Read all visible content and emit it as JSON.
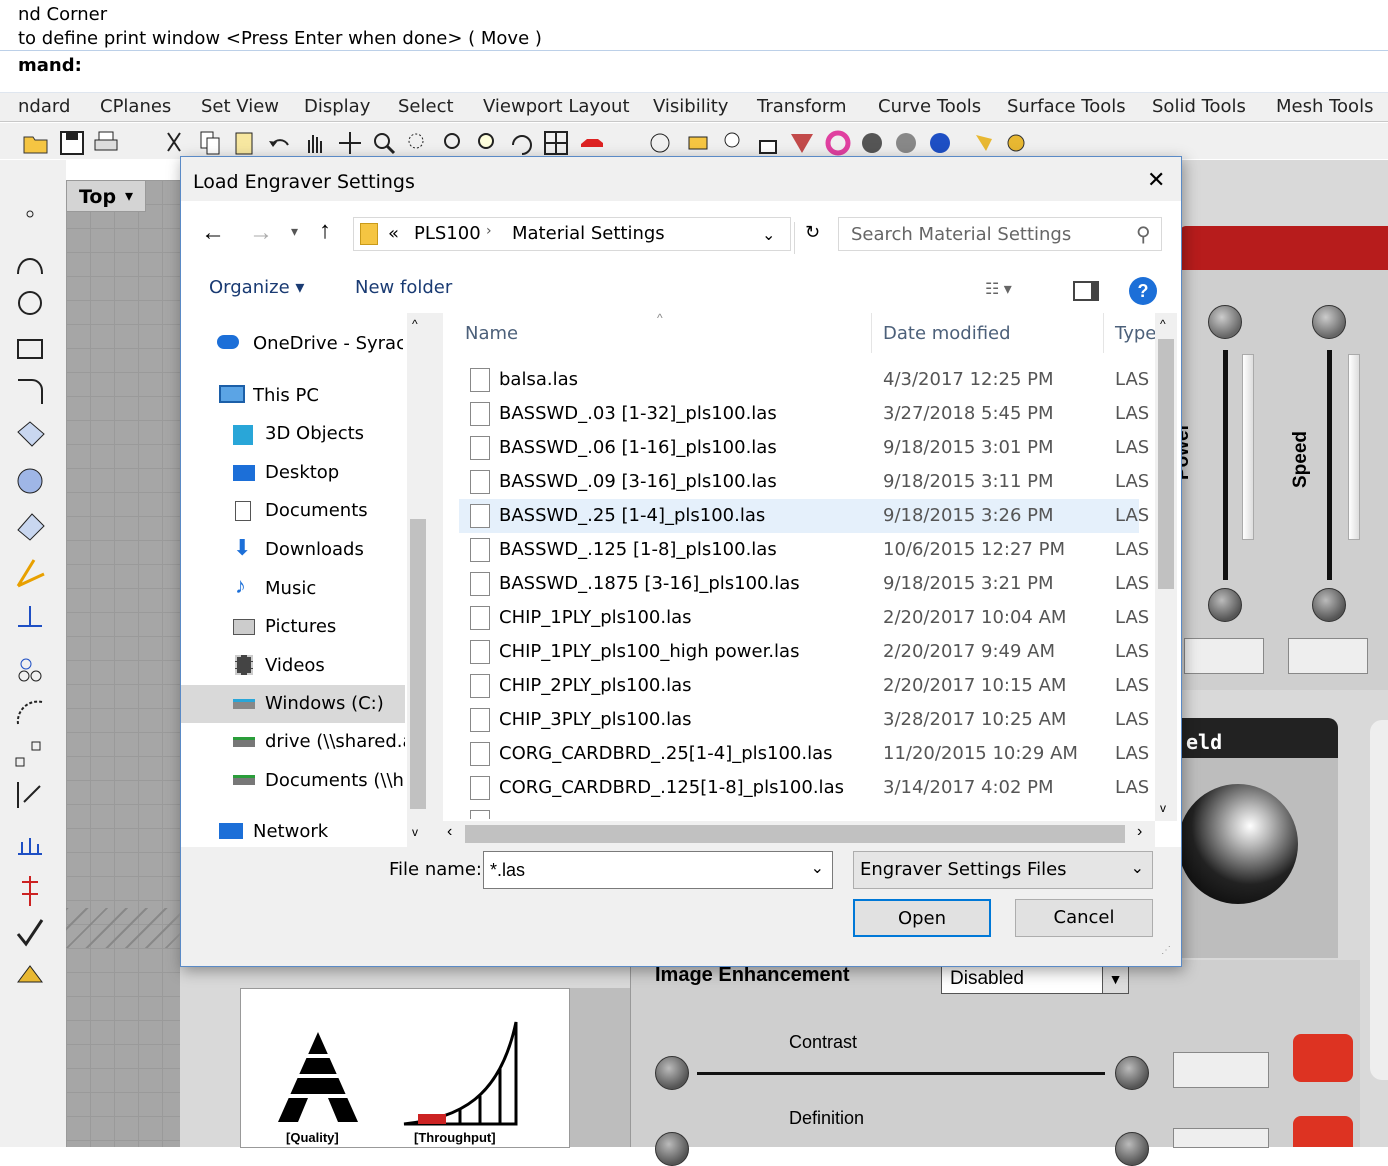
{
  "command": {
    "line1": "nd Corner",
    "line2": "to define print window <Press Enter when done> ( Move )",
    "prompt": "mand:"
  },
  "tabs": [
    "ndard",
    "CPlanes",
    "Set View",
    "Display",
    "Select",
    "Viewport Layout",
    "Visibility",
    "Transform",
    "Curve Tools",
    "Surface Tools",
    "Solid Tools",
    "Mesh Tools"
  ],
  "viewport": {
    "name": "Top"
  },
  "dialog": {
    "title": "Load Engraver Settings",
    "close": "✕",
    "path": {
      "prefix": "«",
      "segment1": "PLS100",
      "segment2": "Material Settings"
    },
    "search_placeholder": "Search Material Settings",
    "organize": "Organize ▾",
    "new_folder": "New folder",
    "tree": [
      "OneDrive - Syracu",
      "This PC",
      "3D Objects",
      "Desktop",
      "Documents",
      "Downloads",
      "Music",
      "Pictures",
      "Videos",
      "Windows (C:)",
      "drive (\\\\shared.a",
      "Documents (\\\\h",
      "Network"
    ],
    "columns": {
      "name": "Name",
      "date": "Date modified",
      "type": "Type"
    },
    "files": [
      {
        "name": "balsa.las",
        "date": "4/3/2017 12:25 PM",
        "type": "LAS I"
      },
      {
        "name": "BASSWD_.03 [1-32]_pls100.las",
        "date": "3/27/2018 5:45 PM",
        "type": "LAS I"
      },
      {
        "name": "BASSWD_.06 [1-16]_pls100.las",
        "date": "9/18/2015 3:01 PM",
        "type": "LAS I"
      },
      {
        "name": "BASSWD_.09 [3-16]_pls100.las",
        "date": "9/18/2015 3:11 PM",
        "type": "LAS I"
      },
      {
        "name": "BASSWD_.25 [1-4]_pls100.las",
        "date": "9/18/2015 3:26 PM",
        "type": "LAS I"
      },
      {
        "name": "BASSWD_.125 [1-8]_pls100.las",
        "date": "10/6/2015 12:27 PM",
        "type": "LAS I"
      },
      {
        "name": "BASSWD_.1875 [3-16]_pls100.las",
        "date": "9/18/2015 3:21 PM",
        "type": "LAS I"
      },
      {
        "name": "CHIP_1PLY_pls100.las",
        "date": "2/20/2017 10:04 AM",
        "type": "LAS I"
      },
      {
        "name": "CHIP_1PLY_pls100_high power.las",
        "date": "2/20/2017 9:49 AM",
        "type": "LAS I"
      },
      {
        "name": "CHIP_2PLY_pls100.las",
        "date": "2/20/2017 10:15 AM",
        "type": "LAS I"
      },
      {
        "name": "CHIP_3PLY_pls100.las",
        "date": "3/28/2017 10:25 AM",
        "type": "LAS I"
      },
      {
        "name": "CORG_CARDBRD_.25[1-4]_pls100.las",
        "date": "11/20/2015 10:29 AM",
        "type": "LAS I"
      },
      {
        "name": "CORG_CARDBRD_.125[1-8]_pls100.las",
        "date": "3/14/2017 4:02 PM",
        "type": "LAS I"
      }
    ],
    "file_name_label": "File name:",
    "file_name_value": "*.las",
    "file_type": "Engraver Settings Files",
    "open": "Open",
    "cancel": "Cancel"
  },
  "plugin": {
    "power": "Power",
    "speed": "Speed",
    "field_partial": "eld",
    "image_enhancement": "Image Enhancement",
    "enhancement_value": "Disabled",
    "contrast": "Contrast",
    "definition": "Definition",
    "quality": "[Quality]",
    "throughput": "[Throughput]"
  }
}
